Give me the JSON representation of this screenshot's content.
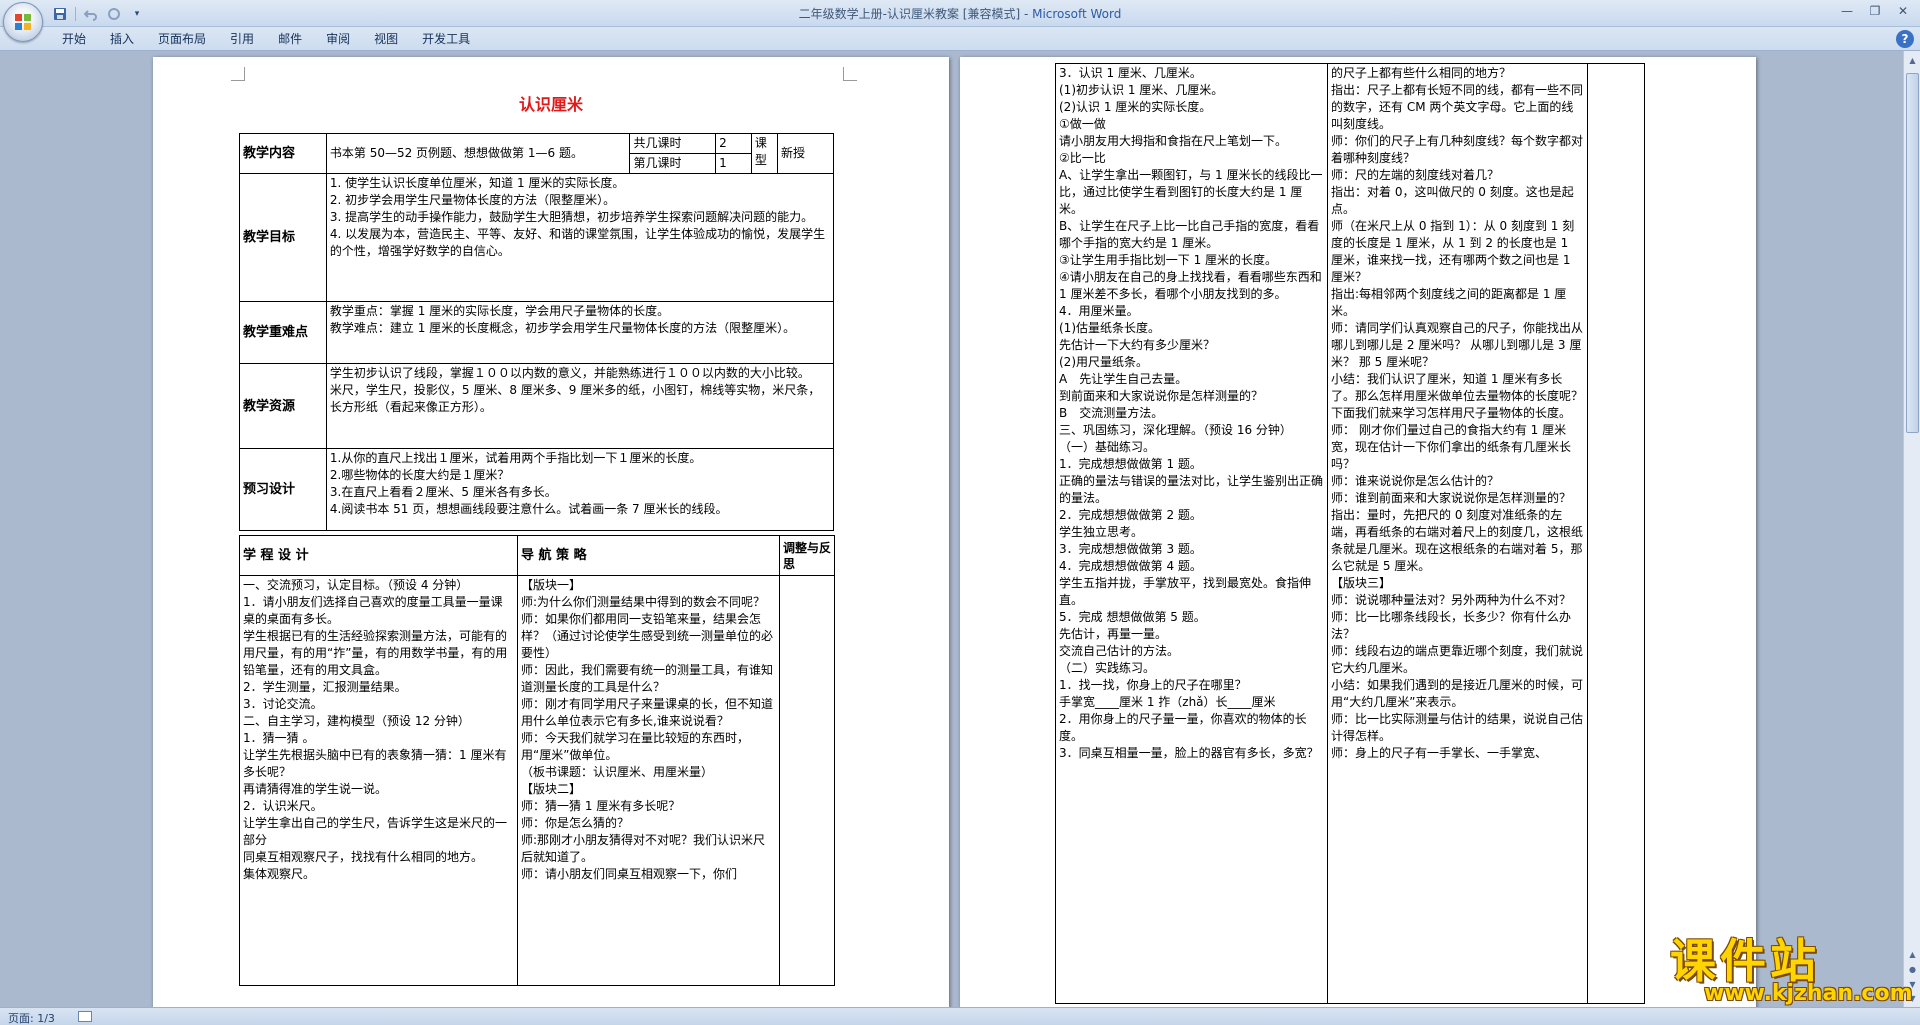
{
  "window": {
    "doc_name": "二年级数学上册-认识厘米教案 [兼容模式] - ",
    "app_name": "Microsoft Word"
  },
  "qat": {
    "save_icon": "save-icon",
    "undo_icon": "undo-icon",
    "redo_icon": "redo-icon",
    "more_icon": "customize-icon"
  },
  "ribbon": {
    "tabs": [
      "开始",
      "插入",
      "页面布局",
      "引用",
      "邮件",
      "审阅",
      "视图",
      "开发工具"
    ],
    "help": "?"
  },
  "page1": {
    "title": "认识厘米",
    "t1": {
      "content_label": "教学内容",
      "content_value": "书本第 50—52 页例题、想想做做第 1—6 题。",
      "total_hours_label": "共几课时",
      "total_hours_value": "2",
      "which_hour_label": "第几课时",
      "which_hour_value": "1",
      "type_label": "课型",
      "type_value": "新授",
      "goal_label": "教学目标",
      "goals": [
        "1. 使学生认识长度单位厘米，知道 1 厘米的实际长度。",
        "2. 初步学会用学生尺量物体长度的方法（限整厘米）。",
        "3. 提高学生的动手操作能力，鼓励学生大胆猜想，初步培养学生探索问题解决问题的能力。",
        "4. 以发展为本，营造民主、平等、友好、和谐的课堂氛围，让学生体验成功的愉悦，发展学生的个性，增强学好数学的自信心。"
      ],
      "key_label": "教学重难点",
      "keys": [
        "教学重点：掌握 1 厘米的实际长度，学会用尺子量物体的长度。",
        "教学难点：建立 1 厘米的长度概念，初步学会用学生尺量物体长度的方法（限整厘米）。"
      ],
      "res_label": "教学资源",
      "res": [
        "学生初步认识了线段，掌握１００以内数的意义，并能熟练进行１００以内数的大小比较。",
        "米尺，学生尺，投影仪，5 厘米、8 厘米多、9 厘米多的纸，小图钉，棉线等实物，米尺条，长方形纸（看起来像正方形）。"
      ],
      "pre_label": "预习设计",
      "pre": [
        "1.从你的直尺上找出１厘米，试着用两个手指比划一下１厘米的长度。",
        "2.哪些物体的长度大约是１厘米？",
        "3.在直尺上看看２厘米、5 厘米各有多长。",
        "4.阅读书本 51 页，想想画线段要注意什么。试着画一条 7 厘米长的线段。"
      ]
    },
    "t2": {
      "h1": "学 程 设 计",
      "h2": "导 航 策 略",
      "h3": "调整与反思",
      "col1": [
        "一、交流预习，认定目标。（预设 4 分钟）",
        "1．请小朋友们选择自己喜欢的度量工具量一量课桌的桌面有多长。",
        "学生根据已有的生活经验探索测量方法，可能有的用尺量，有的用“拃”量，有的用数学书量，有的用铅笔量，还有的用文具盒。",
        "2．学生测量，汇报测量结果。",
        "3．讨论交流。",
        "二、自主学习，建构模型（预设 12 分钟）",
        "1．猜一猜 。",
        "让学生先根据头脑中已有的表象猜一猜：1 厘米有多长呢？",
        "再请猜得准的学生说一说。",
        "2．认识米尺。",
        "让学生拿出自己的学生尺，告诉学生这是米尺的一部分",
        "同桌互相观察尺子，找找有什么相同的地方。",
        "集体观察尺。"
      ],
      "col2": [
        "【版块一】",
        "师:为什么你们测量结果中得到的数会不同呢？",
        "师：如果你们都用同一支铅笔来量，结果会怎样？（通过讨论使学生感受到统一测量单位的必要性）",
        "师：因此，我们需要有统一的测量工具，有谁知道测量长度的工具是什么？",
        "师：刚才有同学用尺子来量课桌的长，但不知道用什么单位表示它有多长,谁来说说看？",
        "师：今天我们就学习在量比较短的东西时，用“厘米”做单位。",
        "（板书课题：认识厘米、用厘米量）",
        "【版块二】",
        "师：猜一猜 1 厘米有多长呢？",
        "师：你是怎么猜的？",
        "师:那刚才小朋友猜得对不对呢？我们认识米尺后就知道了。",
        "师：请小朋友们同桌互相观察一下，你们"
      ]
    }
  },
  "page2": {
    "col1": [
      "3．认识 1 厘米、几厘米。",
      "(1)初步认识 1 厘米、几厘米。",
      "(2)认识 1 厘米的实际长度。",
      "①做一做",
      "请小朋友用大拇指和食指在尺上笔划一下。",
      "②比一比",
      "A、让学生拿出一颗图钉，与 1 厘米长的线段比一比，通过比使学生看到图钉的长度大约是 1 厘米。",
      "B、让学生在尺子上比一比自己手指的宽度，看看哪个手指的宽大约是 1 厘米。",
      "③让学生用手指比划一下 1 厘米的长度。",
      "④请小朋友在自己的身上找找看，看看哪些东西和 1 厘米差不多长，看哪个小朋友找到的多。",
      "4．用厘米量。",
      "(1)估量纸条长度。",
      "先估计一下大约有多少厘米？",
      "(2)用尺量纸条。",
      "A　先让学生自己去量。",
      "到前面来和大家说说你是怎样测量的？",
      "B　交流测量方法。",
      "三、巩固练习，深化理解。（预设 16 分钟）",
      "（一）基础练习。",
      "1．完成想想做做第 1 题。",
      "正确的量法与错误的量法对比，让学生鉴别出正确的量法。",
      "2．完成想想做做第 2 题。",
      "学生独立思考。",
      "3．完成想想做做第 3 题。",
      "4．完成想想做做第 4 题。",
      "学生五指并拢，手掌放平，找到最宽处。食指伸直。",
      "5．完成 想想做做第 5 题。",
      "先估计，再量一量。",
      "交流自己估计的方法。",
      "（二）实践练习。",
      "1．找一找，你身上的尺子在哪里？",
      "手掌宽____厘米 1 拃（zhǎ）长____厘米",
      "2．用你身上的尺子量一量，你喜欢的物体的长度。",
      "3．同桌互相量一量，脸上的器官有多长，多宽？"
    ],
    "col2": [
      "的尺子上都有些什么相同的地方？",
      "指出：尺子上都有长短不同的线，都有一些不同的数字，还有 CM 两个英文字母。它上面的线叫刻度线。",
      "师：你们的尺子上有几种刻度线？每个数字都对着哪种刻度线？",
      "师：尺的左端的刻度线对着几？",
      "指出：对着 0，这叫做尺的 0 刻度。这也是起点。",
      "师（在米尺上从 0 指到 1）：从 0 刻度到 1 刻度的长度是 1 厘米，从 1 到 2 的长度也是 1 厘米，谁来找一找，还有哪两个数之间也是 1 厘米？",
      "指出:每相邻两个刻度线之间的距离都是 1 厘米。",
      "师：请同学们认真观察自己的尺子，你能找出从哪儿到哪儿是 2 厘米吗？ 从哪儿到哪儿是 3 厘米？ 那 5 厘米呢？",
      "小结：我们认识了厘米，知道 1 厘米有多长了。那么怎样用厘米做单位去量物体的长度呢？下面我们就来学习怎样用尺子量物体的长度。",
      "师： 刚才你们量过自己的食指大约有 1 厘米宽，现在估计一下你们拿出的纸条有几厘米长吗？",
      "师：谁来说说你是怎么估计的？",
      "师：谁到前面来和大家说说你是怎样测量的？",
      "指出：量时，先把尺的 0 刻度对准纸条的左端，再看纸条的右端对着尺上的刻度几，这根纸条就是几厘米。现在这根纸条的右端对着 5，那么它就是 5 厘米。",
      "【版块三】",
      "师：说说哪种量法对？另外两种为什么不对？",
      "师：比一比哪条线段长，长多少？你有什么办法？",
      "师：线段右边的端点更靠近哪个刻度，我们就说它大约几厘米。",
      "小结：如果我们遇到的是接近几厘米的时候，可用“大约几厘米”来表示。",
      "师：比一比实际测量与估计的结果，说说自己估计得怎样。",
      "师：身上的尺子有一手掌长、一手掌宽、"
    ]
  },
  "status": {
    "page": "页面: 1/3"
  },
  "watermark": {
    "name": "课件站",
    "url": "www.kjzhan.com"
  }
}
